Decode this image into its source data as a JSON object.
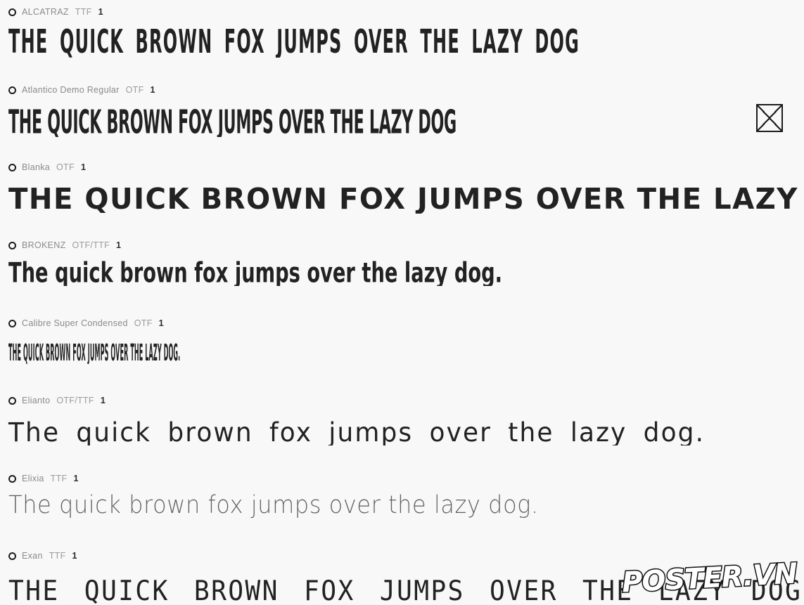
{
  "page": {
    "background_color": "#f8f8f8",
    "text_color": "#222222",
    "meta_name_color": "#8a8a8a",
    "meta_count_color": "#2b2b2b",
    "missing_glyph_label": "missing-glyph-box"
  },
  "fonts": [
    {
      "name": "ALCATRAZ",
      "format": "TTF",
      "count": "1",
      "sample": "THE QUICK BROWN FOX JUMPS OVER THE LAZY DOG",
      "has_missing_glyph": true
    },
    {
      "name": "Atlantico Demo Regular",
      "format": "OTF",
      "count": "1",
      "sample": "THE QUICK BROWN FOX JUMPS OVER THE LAZY DOG",
      "has_missing_glyph": true
    },
    {
      "name": "Blanka",
      "format": "OTF",
      "count": "1",
      "sample": "THE QUICK BROWN FOX JUMPS OVER THE LAZY DOG.",
      "has_missing_glyph": false
    },
    {
      "name": "BROKENZ",
      "format": "OTF/TTF",
      "count": "1",
      "sample": "The quick brown fox jumps over the lazy dog.",
      "has_missing_glyph": false
    },
    {
      "name": "Calibre Super Condensed",
      "format": "OTF",
      "count": "1",
      "sample": "THE QUICK BROWN FOX JUMPS OVER THE LAZY DOG.",
      "has_missing_glyph": false
    },
    {
      "name": "Elianto",
      "format": "OTF/TTF",
      "count": "1",
      "sample": "The quick brown fox jumps over the lazy dog.",
      "has_missing_glyph": false
    },
    {
      "name": "Elixia",
      "format": "TTF",
      "count": "1",
      "sample": "The quick brown fox jumps over the lazy dog.",
      "has_missing_glyph": false
    },
    {
      "name": "Exan",
      "format": "TTF",
      "count": "1",
      "sample": "THE QUICK BROWN FOX JUMPS OVER THE LAZY DOG",
      "has_missing_glyph": true
    }
  ],
  "watermark": {
    "text": "POSTER.VN"
  }
}
